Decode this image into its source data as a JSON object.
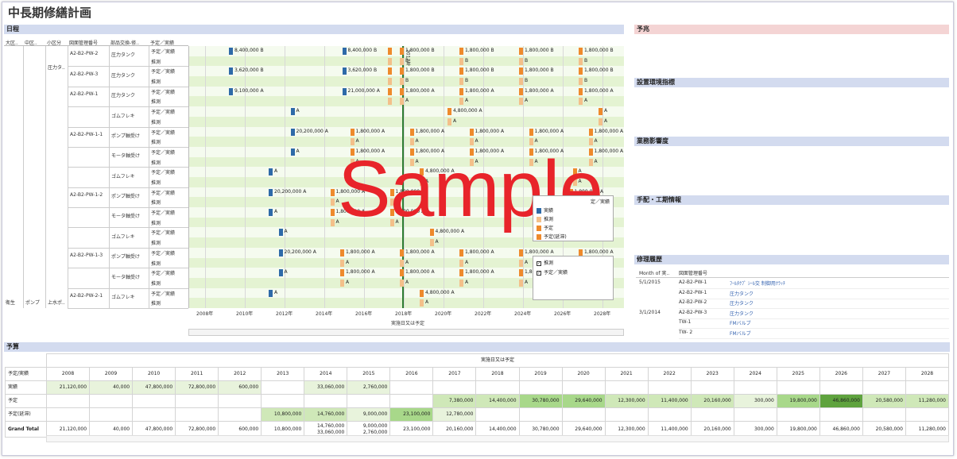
{
  "title": "中長期修繕計画",
  "sections": {
    "schedule": "日程",
    "forecast": "予兆",
    "env": "設置環境指標",
    "impact": "業務影響度",
    "arrange": "手配・工期情報",
    "history": "修理履歴",
    "budget": "予算"
  },
  "sample": "Sample",
  "headers": [
    "大区..",
    "中区..",
    "小区分",
    "図面管理番号",
    "部品交換-修..",
    "予定／実績"
  ],
  "left": {
    "daiku": "衛生",
    "chuku": "ポンプ",
    "shoku1": "圧力タ..",
    "shoku2": "上水ポ.."
  },
  "rows": [
    {
      "dwg": "A2-B2-PW-2",
      "part": "圧力タンク",
      "a": "予定／実績",
      "b": "推測"
    },
    {
      "dwg": "A2-B2-PW-3",
      "part": "圧力タンク",
      "a": "予定／実績",
      "b": "推測"
    },
    {
      "dwg": "A2-B2-PW-1",
      "part": "圧力タンク",
      "a": "予定／実績",
      "b": "推測"
    },
    {
      "dwg": "",
      "part": "ゴムフレキ",
      "a": "予定／実績",
      "b": "推測"
    },
    {
      "dwg": "A2-B2-PW-1-1",
      "part": "ポンプ軸受け",
      "a": "予定／実績",
      "b": "推測"
    },
    {
      "dwg": "",
      "part": "モータ軸受け",
      "a": "予定／実績",
      "b": "推測"
    },
    {
      "dwg": "",
      "part": "ゴムフレキ",
      "a": "予定／実績",
      "b": "推測"
    },
    {
      "dwg": "A2-B2-PW-1-2",
      "part": "ポンプ軸受け",
      "a": "予定／実績",
      "b": "推測"
    },
    {
      "dwg": "",
      "part": "モータ軸受け",
      "a": "予定／実績",
      "b": "推測"
    },
    {
      "dwg": "",
      "part": "ゴムフレキ",
      "a": "予定／実績",
      "b": "推測"
    },
    {
      "dwg": "A2-B2-PW-1-3",
      "part": "ポンプ軸受け",
      "a": "予定／実績",
      "b": "推測"
    },
    {
      "dwg": "",
      "part": "モータ軸受け",
      "a": "予定／実績",
      "b": "推測"
    },
    {
      "dwg": "A2-B2-PW-2-1",
      "part": "ゴムフレキ",
      "a": "予定／実績",
      "b": "推測"
    }
  ],
  "axis": {
    "years": [
      "2008年",
      "2010年",
      "2012年",
      "2014年",
      "2016年",
      "2018年",
      "2020年",
      "2022年",
      "2024年",
      "2026年",
      "2028年"
    ],
    "label": "実施日又は予定"
  },
  "bars": [
    {
      "r": 0,
      "c": "blu",
      "y": 2009.2,
      "t": "8,400,000  B"
    },
    {
      "r": 0,
      "c": "blu",
      "y": 2014.9,
      "t": "8,400,000  B"
    },
    {
      "r": 0,
      "c": "org",
      "y": 2017.2,
      "t": ""
    },
    {
      "r": 0,
      "c": "org",
      "y": 2017.8,
      "t": "1,800,000  B"
    },
    {
      "r": 0,
      "c": "org",
      "y": 2020.8,
      "t": "1,800,000  B"
    },
    {
      "r": 0,
      "c": "org",
      "y": 2023.8,
      "t": "1,800,000  B"
    },
    {
      "r": 0,
      "c": "org",
      "y": 2026.8,
      "t": "1,800,000  B"
    },
    {
      "r": 1,
      "c": "lor",
      "y": 2017.2,
      "t": ""
    },
    {
      "r": 1,
      "c": "lor",
      "y": 2017.8,
      "t": "B"
    },
    {
      "r": 1,
      "c": "lor",
      "y": 2020.8,
      "t": "B"
    },
    {
      "r": 1,
      "c": "lor",
      "y": 2023.8,
      "t": "B"
    },
    {
      "r": 1,
      "c": "lor",
      "y": 2026.8,
      "t": "B"
    },
    {
      "r": 2,
      "c": "blu",
      "y": 2009.2,
      "t": "3,620,000  B"
    },
    {
      "r": 2,
      "c": "blu",
      "y": 2014.9,
      "t": "3,620,000  B"
    },
    {
      "r": 2,
      "c": "org",
      "y": 2017.2,
      "t": ""
    },
    {
      "r": 2,
      "c": "org",
      "y": 2017.8,
      "t": "1,800,000  B"
    },
    {
      "r": 2,
      "c": "org",
      "y": 2020.8,
      "t": "1,800,000  B"
    },
    {
      "r": 2,
      "c": "org",
      "y": 2023.8,
      "t": "1,800,000  B"
    },
    {
      "r": 2,
      "c": "org",
      "y": 2026.8,
      "t": "1,800,000  B"
    },
    {
      "r": 3,
      "c": "lor",
      "y": 2017.2,
      "t": ""
    },
    {
      "r": 3,
      "c": "lor",
      "y": 2017.8,
      "t": "B"
    },
    {
      "r": 3,
      "c": "lor",
      "y": 2020.8,
      "t": "B"
    },
    {
      "r": 3,
      "c": "lor",
      "y": 2023.8,
      "t": "B"
    },
    {
      "r": 3,
      "c": "lor",
      "y": 2026.8,
      "t": "B"
    },
    {
      "r": 4,
      "c": "blu",
      "y": 2009.2,
      "t": "9,100,000  A"
    },
    {
      "r": 4,
      "c": "blu",
      "y": 2014.9,
      "t": "21,000,000  A"
    },
    {
      "r": 4,
      "c": "org",
      "y": 2017.2,
      "t": ""
    },
    {
      "r": 4,
      "c": "org",
      "y": 2017.8,
      "t": "1,800,000  A"
    },
    {
      "r": 4,
      "c": "org",
      "y": 2020.8,
      "t": "1,800,000  A"
    },
    {
      "r": 4,
      "c": "org",
      "y": 2023.8,
      "t": "1,800,000  A"
    },
    {
      "r": 4,
      "c": "org",
      "y": 2026.8,
      "t": "1,800,000  A"
    },
    {
      "r": 5,
      "c": "lor",
      "y": 2017.2,
      "t": ""
    },
    {
      "r": 5,
      "c": "lor",
      "y": 2017.8,
      "t": "A"
    },
    {
      "r": 5,
      "c": "lor",
      "y": 2020.8,
      "t": "A"
    },
    {
      "r": 5,
      "c": "lor",
      "y": 2023.8,
      "t": "A"
    },
    {
      "r": 5,
      "c": "lor",
      "y": 2026.8,
      "t": "A"
    },
    {
      "r": 6,
      "c": "blu",
      "y": 2012.3,
      "t": "A"
    },
    {
      "r": 6,
      "c": "org",
      "y": 2020.2,
      "t": "4,800,000  A"
    },
    {
      "r": 6,
      "c": "org",
      "y": 2027.8,
      "t": "A"
    },
    {
      "r": 7,
      "c": "lor",
      "y": 2020.2,
      "t": "A"
    },
    {
      "r": 7,
      "c": "lor",
      "y": 2027.8,
      "t": "A"
    },
    {
      "r": 8,
      "c": "blu",
      "y": 2012.3,
      "t": "20,200,000  A"
    },
    {
      "r": 8,
      "c": "org",
      "y": 2015.3,
      "t": "1,800,000  A"
    },
    {
      "r": 8,
      "c": "org",
      "y": 2018.3,
      "t": "1,800,000  A"
    },
    {
      "r": 8,
      "c": "org",
      "y": 2021.3,
      "t": "1,800,000  A"
    },
    {
      "r": 8,
      "c": "org",
      "y": 2024.3,
      "t": "1,800,000  A"
    },
    {
      "r": 8,
      "c": "org",
      "y": 2027.3,
      "t": "1,800,000  A"
    },
    {
      "r": 9,
      "c": "lor",
      "y": 2015.3,
      "t": "A"
    },
    {
      "r": 9,
      "c": "lor",
      "y": 2018.3,
      "t": "A"
    },
    {
      "r": 9,
      "c": "lor",
      "y": 2021.3,
      "t": "A"
    },
    {
      "r": 9,
      "c": "lor",
      "y": 2024.3,
      "t": "A"
    },
    {
      "r": 9,
      "c": "lor",
      "y": 2027.3,
      "t": "A"
    },
    {
      "r": 10,
      "c": "blu",
      "y": 2012.3,
      "t": "A"
    },
    {
      "r": 10,
      "c": "org",
      "y": 2015.3,
      "t": "1,800,000  A"
    },
    {
      "r": 10,
      "c": "org",
      "y": 2018.3,
      "t": "1,800,000  A"
    },
    {
      "r": 10,
      "c": "org",
      "y": 2021.3,
      "t": "1,800,000  A"
    },
    {
      "r": 10,
      "c": "org",
      "y": 2024.3,
      "t": "1,800,000  A"
    },
    {
      "r": 10,
      "c": "org",
      "y": 2027.3,
      "t": "1,800,000  A"
    },
    {
      "r": 11,
      "c": "lor",
      "y": 2015.3,
      "t": "A"
    },
    {
      "r": 11,
      "c": "lor",
      "y": 2018.3,
      "t": "A"
    },
    {
      "r": 11,
      "c": "lor",
      "y": 2021.3,
      "t": "A"
    },
    {
      "r": 11,
      "c": "lor",
      "y": 2024.3,
      "t": "A"
    },
    {
      "r": 11,
      "c": "lor",
      "y": 2027.3,
      "t": "A"
    },
    {
      "r": 12,
      "c": "blu",
      "y": 2011.2,
      "t": "A"
    },
    {
      "r": 12,
      "c": "org",
      "y": 2018.8,
      "t": "4,800,000  A"
    },
    {
      "r": 12,
      "c": "org",
      "y": 2026.5,
      "t": "A"
    },
    {
      "r": 13,
      "c": "lor",
      "y": 2018.8,
      "t": "A"
    },
    {
      "r": 13,
      "c": "lor",
      "y": 2026.5,
      "t": "A"
    },
    {
      "r": 14,
      "c": "blu",
      "y": 2011.2,
      "t": "20,200,000  A"
    },
    {
      "r": 14,
      "c": "org",
      "y": 2014.3,
      "t": "1,800,000  A"
    },
    {
      "r": 14,
      "c": "org",
      "y": 2017.3,
      "t": "1,800,000  A"
    },
    {
      "r": 14,
      "c": "org",
      "y": 2026.3,
      "t": "1,800,000  A"
    },
    {
      "r": 15,
      "c": "lor",
      "y": 2014.3,
      "t": "A"
    },
    {
      "r": 15,
      "c": "lor",
      "y": 2017.3,
      "t": "A"
    },
    {
      "r": 15,
      "c": "lor",
      "y": 2026.3,
      "t": "A"
    },
    {
      "r": 16,
      "c": "blu",
      "y": 2011.2,
      "t": "A"
    },
    {
      "r": 16,
      "c": "org",
      "y": 2014.3,
      "t": "1,800,000  A"
    },
    {
      "r": 16,
      "c": "org",
      "y": 2017.3,
      "t": "1,800,000  A"
    },
    {
      "r": 17,
      "c": "lor",
      "y": 2014.3,
      "t": "A"
    },
    {
      "r": 17,
      "c": "lor",
      "y": 2017.3,
      "t": "A"
    },
    {
      "r": 18,
      "c": "blu",
      "y": 2011.7,
      "t": "A"
    },
    {
      "r": 18,
      "c": "org",
      "y": 2019.3,
      "t": "4,800,000  A"
    },
    {
      "r": 19,
      "c": "lor",
      "y": 2019.3,
      "t": "A"
    },
    {
      "r": 20,
      "c": "blu",
      "y": 2011.7,
      "t": "20,200,000  A"
    },
    {
      "r": 20,
      "c": "org",
      "y": 2014.8,
      "t": "1,800,000  A"
    },
    {
      "r": 20,
      "c": "org",
      "y": 2017.8,
      "t": "1,800,000  A"
    },
    {
      "r": 20,
      "c": "org",
      "y": 2020.8,
      "t": "1,800,000  A"
    },
    {
      "r": 20,
      "c": "org",
      "y": 2023.8,
      "t": "1,800,000  A"
    },
    {
      "r": 20,
      "c": "org",
      "y": 2026.8,
      "t": "1,800,000  A"
    },
    {
      "r": 21,
      "c": "lor",
      "y": 2014.8,
      "t": "A"
    },
    {
      "r": 21,
      "c": "lor",
      "y": 2017.8,
      "t": "A"
    },
    {
      "r": 21,
      "c": "lor",
      "y": 2020.8,
      "t": "A"
    },
    {
      "r": 21,
      "c": "lor",
      "y": 2023.8,
      "t": "A"
    },
    {
      "r": 21,
      "c": "lor",
      "y": 2026.8,
      "t": "A"
    },
    {
      "r": 22,
      "c": "blu",
      "y": 2011.7,
      "t": "A"
    },
    {
      "r": 22,
      "c": "org",
      "y": 2014.8,
      "t": "1,800,000  A"
    },
    {
      "r": 22,
      "c": "org",
      "y": 2017.8,
      "t": "1,800,000  A"
    },
    {
      "r": 22,
      "c": "org",
      "y": 2020.8,
      "t": "1,800,000  A"
    },
    {
      "r": 22,
      "c": "org",
      "y": 2023.8,
      "t": "1,800,000  A"
    },
    {
      "r": 23,
      "c": "lor",
      "y": 2014.8,
      "t": "A"
    },
    {
      "r": 23,
      "c": "lor",
      "y": 2017.8,
      "t": "A"
    },
    {
      "r": 23,
      "c": "lor",
      "y": 2020.8,
      "t": "A"
    },
    {
      "r": 23,
      "c": "lor",
      "y": 2023.8,
      "t": "A"
    },
    {
      "r": 24,
      "c": "blu",
      "y": 2011.2,
      "t": "A"
    },
    {
      "r": 24,
      "c": "org",
      "y": 2018.8,
      "t": "4,800,000  A"
    },
    {
      "r": 25,
      "c": "lor",
      "y": 2018.8,
      "t": "A"
    }
  ],
  "today_label": "2017年",
  "legend1": {
    "items": [
      "実績",
      "推測",
      "予定",
      "予定(延滞)"
    ],
    "colors": [
      "#2e6aa8",
      "#f3c08a",
      "#ee8a2c",
      "#ee8a2c"
    ],
    "extra": "定／実績"
  },
  "legend2": {
    "items": [
      "推測",
      "予定／実績"
    ]
  },
  "history": {
    "headers": [
      "Month of 実..",
      "図面管理番号"
    ],
    "rows": [
      {
        "m": "5/1/2015",
        "d": "A2-B2-PW-1",
        "p": "ﾌｰﾙﾀｸﾌﾟ ｼｰﾙ交   制御用ｸﾗｯﾁ"
      },
      {
        "m": "",
        "d": "A2-B2-PW-1",
        "p": "圧力タンク"
      },
      {
        "m": "",
        "d": "A2-B2-PW-2",
        "p": "圧力タンク"
      },
      {
        "m": "3/1/2014",
        "d": "A2-B2-PW-3",
        "p": "圧力タンク"
      },
      {
        "m": "",
        "d": "TW-1",
        "p": "FMバルブ"
      },
      {
        "m": "",
        "d": "TW- 2",
        "p": "FMバルブ"
      }
    ]
  },
  "budget": {
    "top_label": "実施日又は予定",
    "corner": "予定/実績",
    "years": [
      "2008",
      "2009",
      "2010",
      "2011",
      "2012",
      "2013",
      "2014",
      "2015",
      "2016",
      "2017",
      "2018",
      "2019",
      "2020",
      "2021",
      "2022",
      "2023",
      "2024",
      "2025",
      "2026",
      "2027",
      "2028"
    ],
    "rows": [
      {
        "label": "実績",
        "vals": [
          "21,120,000",
          "40,000",
          "47,800,000",
          "72,800,000",
          "600,000",
          "",
          "33,060,000",
          "2,760,000",
          "",
          "",
          "",
          "",
          "",
          "",
          "",
          "",
          "",
          "",
          "",
          "",
          ""
        ],
        "lv": [
          1,
          1,
          1,
          1,
          1,
          0,
          1,
          1,
          0,
          0,
          0,
          0,
          0,
          0,
          0,
          0,
          0,
          0,
          0,
          0,
          0
        ]
      },
      {
        "label": "予定",
        "vals": [
          "",
          "",
          "",
          "",
          "",
          "",
          "",
          "",
          "",
          "7,380,000",
          "14,400,000",
          "30,780,000",
          "29,640,000",
          "12,300,000",
          "11,400,000",
          "20,160,000",
          "300,000",
          "19,800,000",
          "46,860,000",
          "20,580,000",
          "11,280,000"
        ],
        "lv": [
          0,
          0,
          0,
          0,
          0,
          0,
          0,
          0,
          0,
          2,
          2,
          3,
          3,
          2,
          2,
          2,
          1,
          3,
          4,
          2,
          2
        ]
      },
      {
        "label": "予定(延滞)",
        "vals": [
          "",
          "",
          "",
          "",
          "",
          "10,800,000",
          "14,760,000",
          "9,000,000",
          "23,100,000",
          "12,780,000",
          "",
          "",
          "",
          "",
          "",
          "",
          "",
          "",
          "",
          "",
          ""
        ],
        "lv": [
          0,
          0,
          0,
          0,
          0,
          2,
          2,
          1,
          3,
          1,
          0,
          0,
          0,
          0,
          0,
          0,
          0,
          0,
          0,
          0,
          0
        ]
      },
      {
        "label": "Grand Total",
        "vals": [
          "21,120,000",
          "40,000",
          "47,800,000",
          "72,800,000",
          "600,000",
          "10,800,000",
          "14,760,000\n33,060,000",
          "9,000,000\n2,760,000",
          "23,100,000",
          "20,160,000",
          "14,400,000",
          "30,780,000",
          "29,640,000",
          "12,300,000",
          "11,400,000",
          "20,160,000",
          "300,000",
          "19,800,000",
          "46,860,000",
          "20,580,000",
          "11,280,000"
        ],
        "lv": [
          0,
          0,
          0,
          0,
          0,
          0,
          0,
          0,
          0,
          0,
          0,
          0,
          0,
          0,
          0,
          0,
          0,
          0,
          0,
          0,
          0
        ]
      }
    ]
  }
}
